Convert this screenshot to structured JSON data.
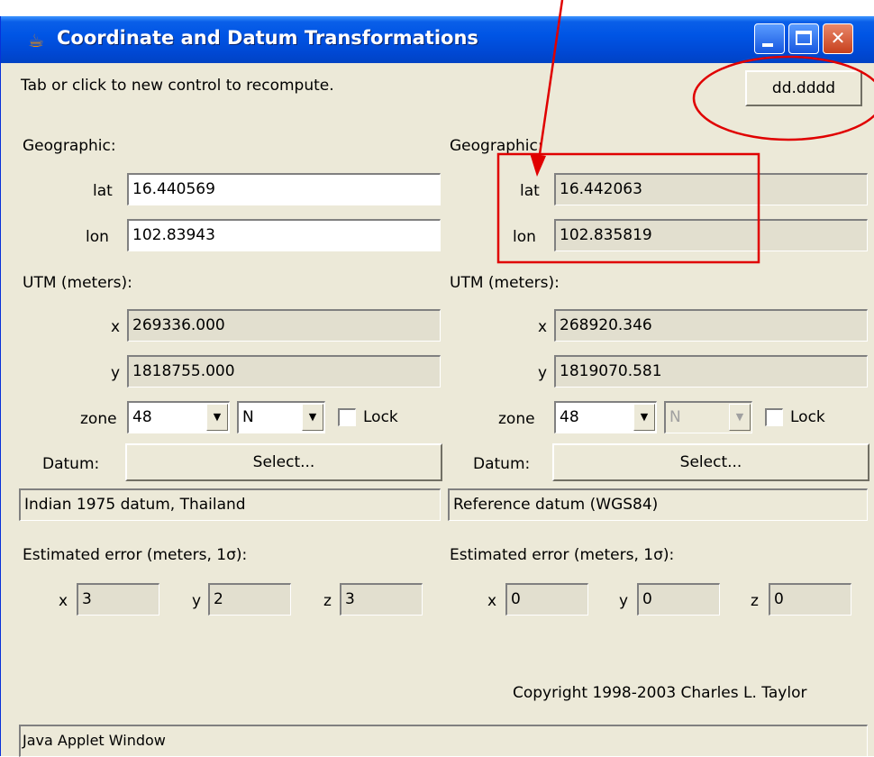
{
  "window": {
    "title": "Coordinate and Datum Transformations",
    "hint": "Tab or click to new control to recompute.",
    "format_button": "dd.dddd",
    "copyright": "Copyright 1998-2003 Charles L. Taylor",
    "status": "Java Applet Window"
  },
  "left": {
    "geo_header": "Geographic:",
    "lat_label": "lat",
    "lat": "16.440569",
    "lon_label": "lon",
    "lon": "102.83943",
    "utm_header": "UTM (meters):",
    "x_label": "x",
    "x": "269336.000",
    "y_label": "y",
    "y": "1818755.000",
    "zone_label": "zone",
    "zone": "48",
    "hemisphere": "N",
    "lock_label": "Lock",
    "datum_label": "Datum:",
    "select_label": "Select...",
    "datum_name": "Indian 1975 datum, Thailand",
    "error_header": "Estimated error (meters, 1σ):",
    "ex_label": "x",
    "ex": "3",
    "ey_label": "y",
    "ey": "2",
    "ez_label": "z",
    "ez": "3"
  },
  "right": {
    "geo_header": "Geographic:",
    "lat_label": "lat",
    "lat": "16.442063",
    "lon_label": "lon",
    "lon": "102.835819",
    "utm_header": "UTM (meters):",
    "x_label": "x",
    "x": "268920.346",
    "y_label": "y",
    "y": "1819070.581",
    "zone_label": "zone",
    "zone": "48",
    "hemisphere": "N",
    "lock_label": "Lock",
    "datum_label": "Datum:",
    "select_label": "Select...",
    "datum_name": "Reference datum (WGS84)",
    "error_header": "Estimated error (meters, 1σ):",
    "ex_label": "x",
    "ex": "0",
    "ey_label": "y",
    "ey": "0",
    "ez_label": "z",
    "ez": "0"
  },
  "icons": {
    "app": "java-cup-icon",
    "minimize": "minimize-icon",
    "maximize": "maximize-icon",
    "close": "close-icon",
    "dropdown": "chevron-down-icon"
  },
  "colors": {
    "titlebar": "#0055e5",
    "face": "#ece9d8",
    "annotation": "#e00000"
  }
}
